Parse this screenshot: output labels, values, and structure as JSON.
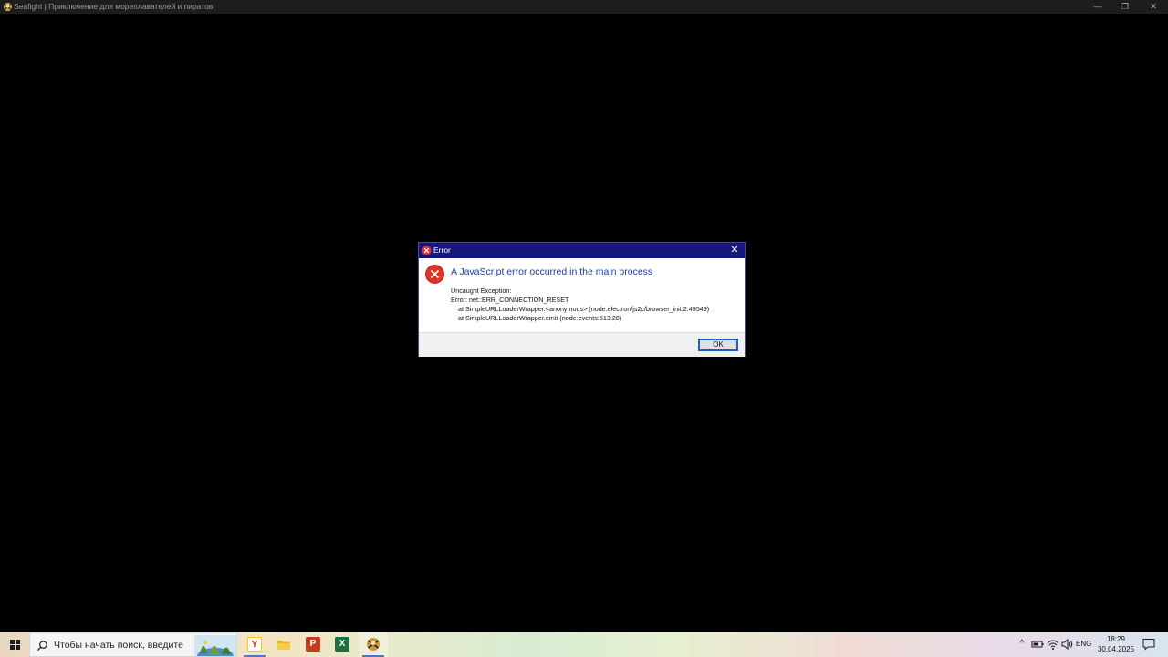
{
  "window": {
    "title": "Seafight | Приключение для мореплавателей и пиратов",
    "controls": {
      "minimize": "—",
      "maximize": "❐",
      "close": "✕"
    }
  },
  "dialog": {
    "title": "Error",
    "close_label": "✕",
    "heading": "A JavaScript error occurred in the main process",
    "detail_lines": [
      "Uncaught Exception:",
      "Error: net::ERR_CONNECTION_RESET",
      "at SimpleURLLoaderWrapper.<anonymous> (node:electron/js2c/browser_init:2:49549)",
      "at SimpleURLLoaderWrapper.emit (node:events:513:28)"
    ],
    "ok_label": "OK",
    "icon": "error-circle-icon"
  },
  "taskbar": {
    "search_placeholder": "Чтобы начать поиск, введите",
    "apps": [
      {
        "name": "yandex-browser",
        "glyph": "Y",
        "color": "#ffcc00"
      },
      {
        "name": "file-explorer",
        "glyph": "",
        "color": "#f2b824"
      },
      {
        "name": "powerpoint",
        "glyph": "P",
        "color": "#c43e1c"
      },
      {
        "name": "excel",
        "glyph": "X",
        "color": "#1d6f42"
      },
      {
        "name": "seafight",
        "glyph": "",
        "color": "#6b5a2a"
      }
    ],
    "tray": {
      "chevron": "^",
      "language": "ENG",
      "time": "18:29",
      "date": "30.04.2025"
    }
  }
}
